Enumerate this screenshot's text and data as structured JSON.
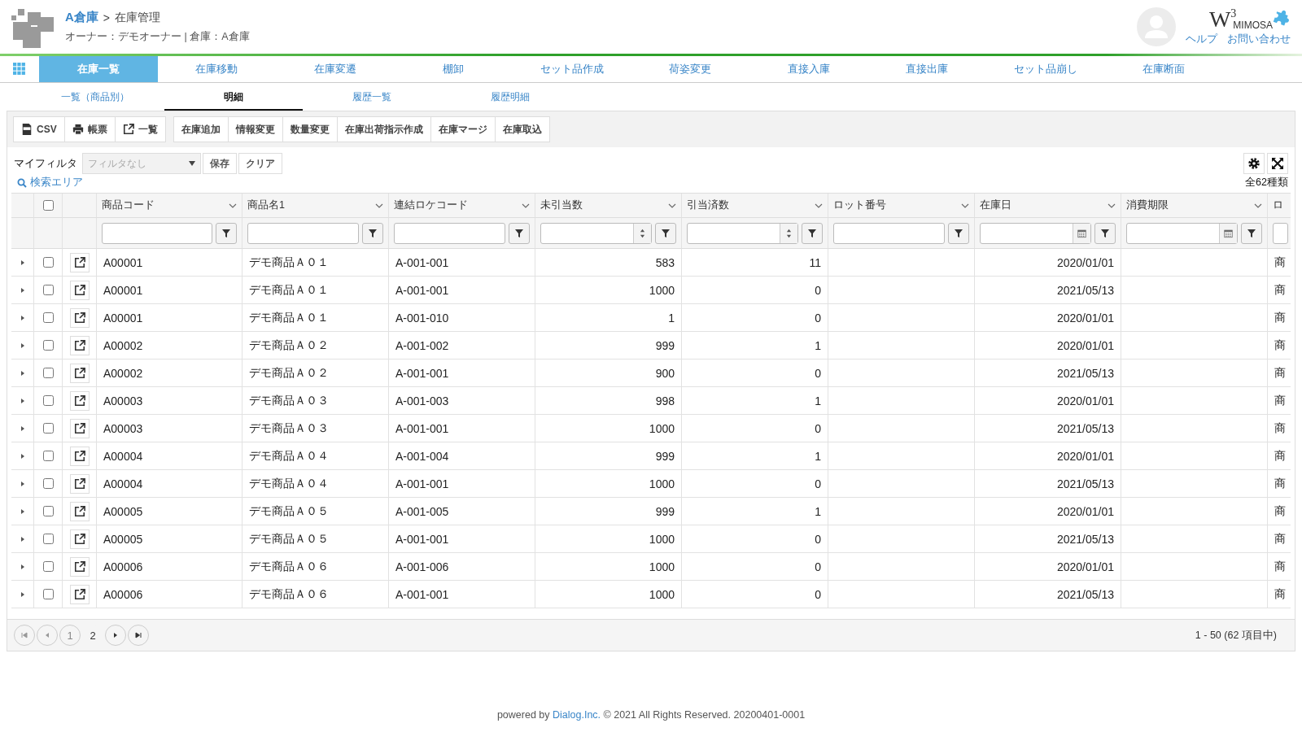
{
  "header": {
    "breadcrumb": {
      "warehouse": "A倉庫",
      "separator": ">",
      "page": "在庫管理"
    },
    "subtitle": "オーナー：デモオーナー | 倉庫：A倉庫",
    "brand": {
      "letter": "W",
      "sup": "3",
      "name": "MIMOSA"
    },
    "links": [
      "ヘルプ",
      "お問い合わせ"
    ]
  },
  "nav_tabs": [
    {
      "label": "在庫一覧",
      "selected": true
    },
    {
      "label": "在庫移動",
      "selected": false
    },
    {
      "label": "在庫変遷",
      "selected": false
    },
    {
      "label": "棚卸",
      "selected": false
    },
    {
      "label": "セット品作成",
      "selected": false
    },
    {
      "label": "荷姿変更",
      "selected": false
    },
    {
      "label": "直接入庫",
      "selected": false
    },
    {
      "label": "直接出庫",
      "selected": false
    },
    {
      "label": "セット品崩し",
      "selected": false
    },
    {
      "label": "在庫断面",
      "selected": false
    }
  ],
  "sub_tabs": [
    {
      "label": "一覧（商品別）",
      "selected": false
    },
    {
      "label": "明細",
      "selected": true
    },
    {
      "label": "履歴一覧",
      "selected": false
    },
    {
      "label": "履歴明細",
      "selected": false
    }
  ],
  "toolbar": [
    [
      {
        "label": "CSV",
        "kind": "csv"
      },
      {
        "label": "帳票",
        "kind": "print"
      },
      {
        "label": "一覧",
        "kind": "external"
      }
    ],
    [
      {
        "label": "在庫追加",
        "kind": "plain"
      },
      {
        "label": "情報変更",
        "kind": "plain"
      },
      {
        "label": "数量変更",
        "kind": "plain"
      },
      {
        "label": "在庫出荷指示作成",
        "kind": "plain"
      },
      {
        "label": "在庫マージ",
        "kind": "plain"
      },
      {
        "label": "在庫取込",
        "kind": "plain"
      }
    ]
  ],
  "my_filter": {
    "label": "マイフィルタ",
    "placeholder": "フィルタなし",
    "buttons": [
      "保存",
      "クリア"
    ]
  },
  "search_area": "検索エリア",
  "total": "全62種類",
  "table": {
    "select_all_checked": false,
    "columns": [
      {
        "label": "商品コード",
        "kind": "text"
      },
      {
        "label": "商品名1",
        "kind": "text"
      },
      {
        "label": "連結ロケコード",
        "kind": "text"
      },
      {
        "label": "未引当数",
        "kind": "number"
      },
      {
        "label": "引当済数",
        "kind": "number"
      },
      {
        "label": "ロット番号",
        "kind": "text"
      },
      {
        "label": "在庫日",
        "kind": "date"
      },
      {
        "label": "消費期限",
        "kind": "date"
      },
      {
        "label": "ロ",
        "kind": "partial"
      }
    ],
    "rows": [
      {
        "checked": false,
        "cells": [
          "A00001",
          "デモ商品Ａ０１",
          "A-001-001",
          "583",
          "11",
          "",
          "2020/01/01",
          "",
          "商"
        ]
      },
      {
        "checked": false,
        "cells": [
          "A00001",
          "デモ商品Ａ０１",
          "A-001-001",
          "1000",
          "0",
          "",
          "2021/05/13",
          "",
          "商"
        ]
      },
      {
        "checked": false,
        "cells": [
          "A00001",
          "デモ商品Ａ０１",
          "A-001-010",
          "1",
          "0",
          "",
          "2020/01/01",
          "",
          "商"
        ]
      },
      {
        "checked": false,
        "cells": [
          "A00002",
          "デモ商品Ａ０２",
          "A-001-002",
          "999",
          "1",
          "",
          "2020/01/01",
          "",
          "商"
        ]
      },
      {
        "checked": false,
        "cells": [
          "A00002",
          "デモ商品Ａ０２",
          "A-001-001",
          "900",
          "0",
          "",
          "2021/05/13",
          "",
          "商"
        ]
      },
      {
        "checked": false,
        "cells": [
          "A00003",
          "デモ商品Ａ０３",
          "A-001-003",
          "998",
          "1",
          "",
          "2020/01/01",
          "",
          "商"
        ]
      },
      {
        "checked": false,
        "cells": [
          "A00003",
          "デモ商品Ａ０３",
          "A-001-001",
          "1000",
          "0",
          "",
          "2021/05/13",
          "",
          "商"
        ]
      },
      {
        "checked": false,
        "cells": [
          "A00004",
          "デモ商品Ａ０４",
          "A-001-004",
          "999",
          "1",
          "",
          "2020/01/01",
          "",
          "商"
        ]
      },
      {
        "checked": false,
        "cells": [
          "A00004",
          "デモ商品Ａ０４",
          "A-001-001",
          "1000",
          "0",
          "",
          "2021/05/13",
          "",
          "商"
        ]
      },
      {
        "checked": false,
        "cells": [
          "A00005",
          "デモ商品Ａ０５",
          "A-001-005",
          "999",
          "1",
          "",
          "2020/01/01",
          "",
          "商"
        ]
      },
      {
        "checked": false,
        "cells": [
          "A00005",
          "デモ商品Ａ０５",
          "A-001-001",
          "1000",
          "0",
          "",
          "2021/05/13",
          "",
          "商"
        ]
      },
      {
        "checked": false,
        "cells": [
          "A00006",
          "デモ商品Ａ０６",
          "A-001-006",
          "1000",
          "0",
          "",
          "2020/01/01",
          "",
          "商"
        ]
      },
      {
        "checked": false,
        "cells": [
          "A00006",
          "デモ商品Ａ０６",
          "A-001-001",
          "1000",
          "0",
          "",
          "2021/05/13",
          "",
          "商"
        ]
      }
    ]
  },
  "pager": {
    "pages": [
      {
        "label": "1",
        "selected": true
      },
      {
        "label": "2",
        "selected": false
      }
    ],
    "summary": "1 - 50 (62 項目中)"
  },
  "footer": {
    "prefix": "powered by",
    "link": "Dialog.Inc.",
    "suffix": "© 2021 All Rights Reserved. 20200401-0001"
  }
}
